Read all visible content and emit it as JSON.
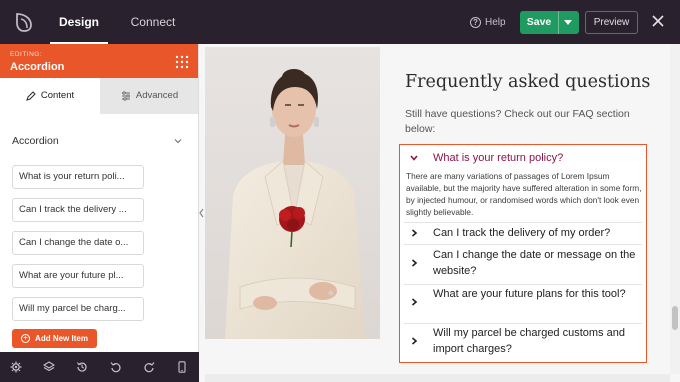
{
  "topbar": {
    "logo_icon": "seedprod-leaf-icon",
    "tabs": [
      {
        "label": "Design",
        "active": true
      },
      {
        "label": "Connect",
        "active": false
      }
    ],
    "help_label": "Help",
    "save_label": "Save",
    "preview_label": "Preview",
    "close_icon": "close-icon"
  },
  "sidebar": {
    "editing_small": "EDITING:",
    "editing_title": "Accordion",
    "tabs": [
      {
        "label": "Content",
        "icon": "pencil-icon",
        "active": true
      },
      {
        "label": "Advanced",
        "icon": "sliders-icon",
        "active": false
      }
    ],
    "section_title": "Accordion",
    "items": [
      "What is your return poli...",
      "Can I track the delivery ...",
      "Can I change the date o...",
      "What are your future pl...",
      "Will my parcel be charg..."
    ],
    "add_item_label": "Add New Item",
    "accent": "#e8562a"
  },
  "bottom_toolbar": {
    "icons": [
      "settings-icon",
      "layers-icon",
      "history-icon",
      "undo-icon",
      "redo-icon",
      "mobile-preview-icon"
    ]
  },
  "page": {
    "faq_title": "Frequently asked questions",
    "faq_subtitle": "Still have questions? Check out our FAQ section below:",
    "accordion": [
      {
        "question": "What is your return policy?",
        "open": true,
        "answer": "There are many variations of passages of Lorem Ipsum available, but the majority have suffered alteration in some form, by injected humour, or randomised words which don't look even slightly believable."
      },
      {
        "question": "Can I track the delivery of my order?",
        "open": false
      },
      {
        "question": "Can I change the date or message on the website?",
        "open": false
      },
      {
        "question": "What are your future plans for this tool?",
        "open": false
      },
      {
        "question": "Will my parcel be charged customs and import charges?",
        "open": false
      }
    ],
    "open_color": "#8d1549",
    "border_color": "#e8562a"
  }
}
